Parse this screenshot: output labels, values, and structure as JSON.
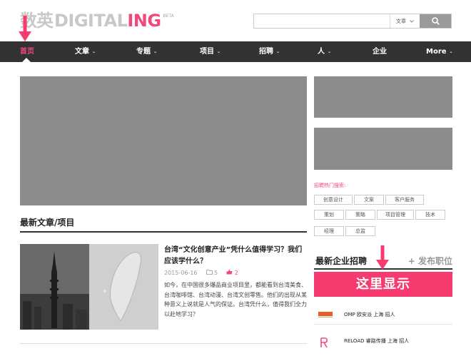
{
  "header": {
    "logo_cn": "数英",
    "logo_digital": "DIGITAL",
    "logo_ing": "ING",
    "logo_beta": "BETA",
    "search_placeholder": "",
    "search_scope": "文章"
  },
  "nav": {
    "items": [
      {
        "label": "首页"
      },
      {
        "label": "文章"
      },
      {
        "label": "专题"
      },
      {
        "label": "项目"
      },
      {
        "label": "招聘"
      },
      {
        "label": "人"
      },
      {
        "label": "企业"
      },
      {
        "label": "More"
      }
    ]
  },
  "main": {
    "section_title": "最新文章/项目",
    "article": {
      "title": "台湾“文化创意产业”凭什么值得学习？我们应该学什么？",
      "date": "2015-06-16",
      "comments": "5",
      "likes": "2",
      "desc": "如今，在中国很多爆品商业项目里，都能看到台湾美食、台湾咖啡馆、台湾动漫、台湾文创零售。他们的出现从某种意义上说就是人气的保证。台湾凭什么，值得我们全力以赴地学习？"
    }
  },
  "sidebar": {
    "hot_title": "招聘热门搜索:",
    "tags": [
      "创意设计",
      "文案",
      "客户服务",
      "策划",
      "策略",
      "项目管理",
      "技术",
      "经理",
      "总监"
    ],
    "recruit_title": "最新企业招聘",
    "recruit_post": "+ 发布职位",
    "highlight": "这里显示",
    "companies": [
      {
        "name": "OMP 欧安派 上海 招人",
        "logo_color": "#e85c2b"
      },
      {
        "name": "RELOAD 睿路传播 上海 招人",
        "logo_color": "#f2487c"
      }
    ]
  },
  "colors": {
    "accent": "#f2487c",
    "highlight": "#f73b6f",
    "nav_bg": "#323232"
  }
}
